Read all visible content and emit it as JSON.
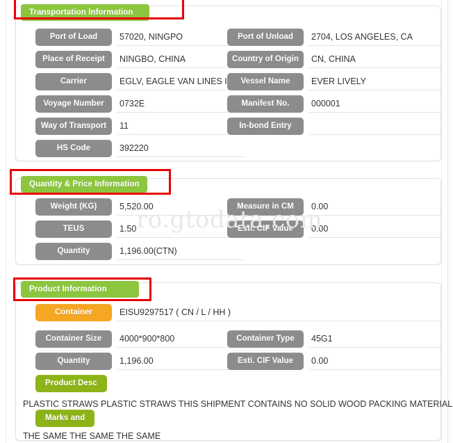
{
  "watermark": "ro.gtodata.com",
  "colors": {
    "section_header_green": "#8cc63f",
    "label_gray": "#8c8c8c",
    "label_orange": "#f5a623",
    "label_olive": "#8cb317",
    "annotation_red": "#e60000",
    "value_text": "#333333"
  },
  "sections": [
    {
      "id": "transportation",
      "title": "Transportation Information",
      "annotated": true,
      "rows": [
        {
          "left_label": "Port of Load",
          "left_value": "57020, NINGPO",
          "right_label": "Port of Unload",
          "right_value": "2704, LOS ANGELES, CA"
        },
        {
          "left_label": "Place of Receipt",
          "left_value": "NINGBO, CHINA",
          "right_label": "Country of Origin",
          "right_value": "CN, CHINA"
        },
        {
          "left_label": "Carrier",
          "left_value": "EGLV, EAGLE VAN LINES INC",
          "right_label": "Vessel Name",
          "right_value": "EVER LIVELY"
        },
        {
          "left_label": "Voyage Number",
          "left_value": "0732E",
          "right_label": "Manifest No.",
          "right_value": "000001"
        },
        {
          "left_label": "Way of Transport",
          "left_value": "11",
          "right_label": "In-bond Entry",
          "right_value": ""
        },
        {
          "left_label": "HS Code",
          "left_value": "392220",
          "right_label": "",
          "right_value": ""
        }
      ]
    },
    {
      "id": "quantity_price",
      "title": "Quantity & Price Information",
      "annotated": true,
      "rows": [
        {
          "left_label": "Weight (KG)",
          "left_value": "5,520.00",
          "right_label": "Measure in CM",
          "right_value": "0.00"
        },
        {
          "left_label": "TEUS",
          "left_value": "1.50",
          "right_label": "Esti. CIF Value",
          "right_value": "0.00"
        },
        {
          "left_label": "Quantity",
          "left_value": "1,196.00(CTN)",
          "right_label": "",
          "right_value": ""
        }
      ]
    },
    {
      "id": "product",
      "title": "Product Information",
      "annotated": true,
      "container_row": {
        "label": "Container",
        "value": "EISU9297517 ( CN / L / HH )"
      },
      "rows": [
        {
          "left_label": "Container Size",
          "left_value": "4000*900*800",
          "right_label": "Container Type",
          "right_value": "45G1"
        },
        {
          "left_label": "Quantity",
          "left_value": "1,196.00",
          "right_label": "Esti. CIF Value",
          "right_value": "0.00"
        }
      ],
      "text_blocks": [
        {
          "label": "Product Desc",
          "text": "PLASTIC STRAWS PLASTIC STRAWS THIS SHIPMENT CONTAINS NO SOLID WOOD PACKING MATERIALS."
        },
        {
          "label": "Marks and",
          "text": "THE SAME THE SAME THE SAME"
        }
      ]
    }
  ]
}
